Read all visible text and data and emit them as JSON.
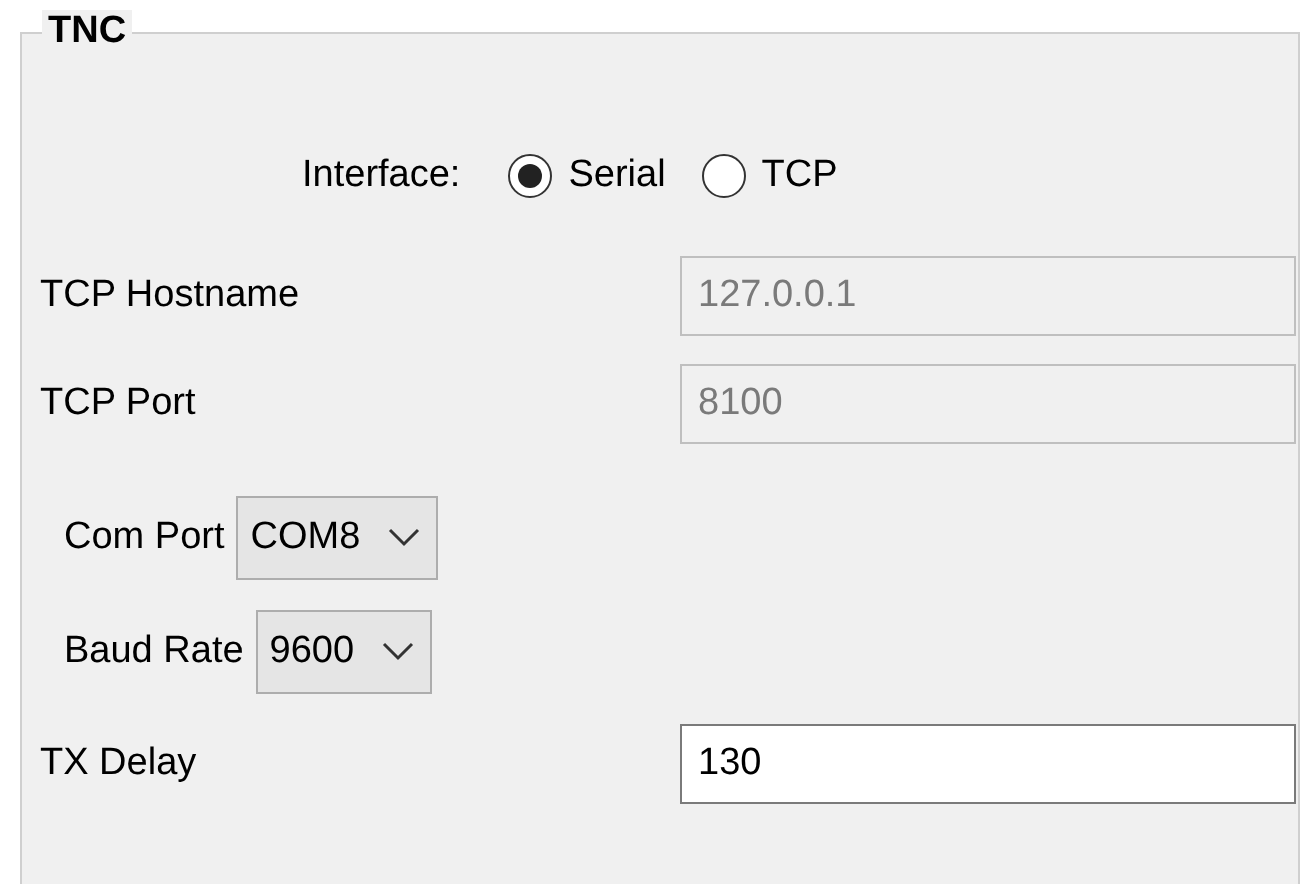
{
  "group": {
    "title": "TNC"
  },
  "interface": {
    "label": "Interface:",
    "options": [
      {
        "label": "Serial",
        "selected": true
      },
      {
        "label": "TCP",
        "selected": false
      }
    ]
  },
  "fields": [
    {
      "kind": "text",
      "label": "TCP Hostname",
      "value": "127.0.0.1",
      "disabled": true
    },
    {
      "kind": "text",
      "label": "TCP Port",
      "value": "8100",
      "disabled": true
    },
    {
      "kind": "combo",
      "label": "Com Port",
      "value": "COM8"
    },
    {
      "kind": "combo",
      "label": "Baud Rate",
      "value": "9600"
    },
    {
      "kind": "text",
      "label": "TX Delay",
      "value": "130",
      "disabled": false
    }
  ]
}
